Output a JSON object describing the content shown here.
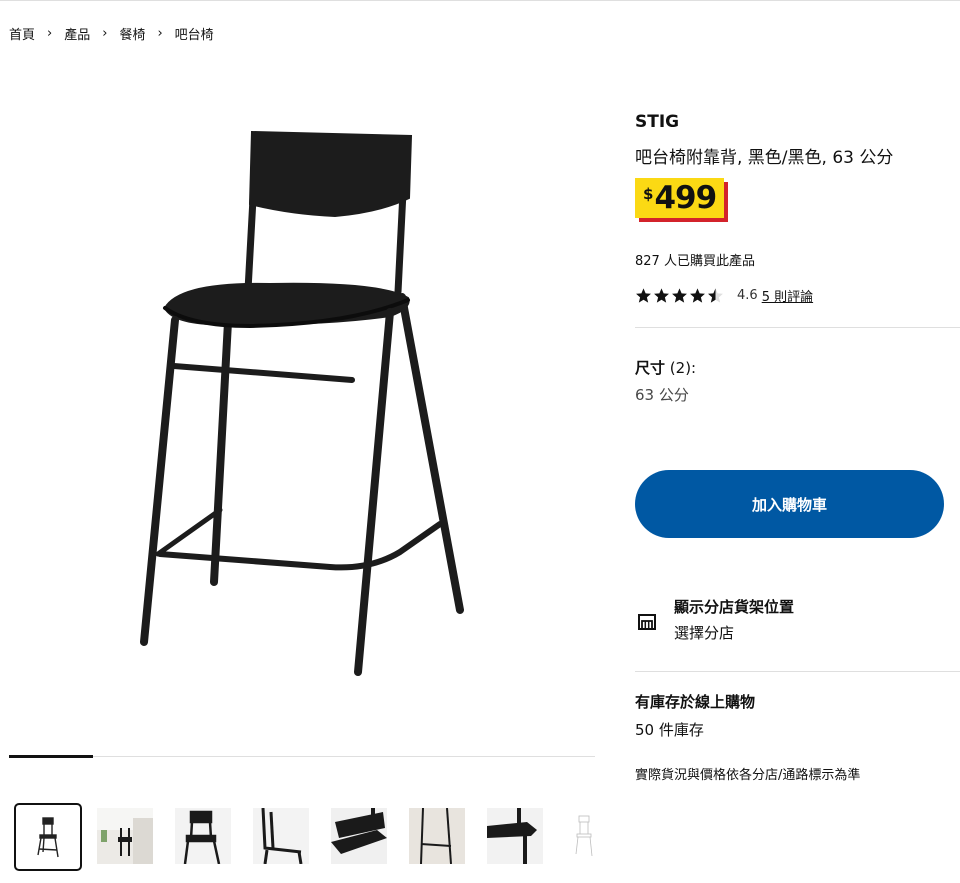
{
  "breadcrumb": [
    "首頁",
    "產品",
    "餐椅",
    "吧台椅"
  ],
  "product": {
    "brand": "STIG",
    "description": "吧台椅附靠背, 黑色/黑色, 63 公分",
    "price_currency": "$",
    "price_value": "499",
    "sold_text": "827 人已購買此產品",
    "rating_value": "4.6",
    "rating_stars": 4.5,
    "reviews_label": "5 則評論",
    "size_label": "尺寸",
    "size_count": "(2):",
    "size_value": "63 公分",
    "add_to_cart": "加入購物車",
    "store_title": "顯示分店貨架位置",
    "store_sub": "選擇分店",
    "stock_title": "有庫存於線上購物",
    "stock_count": "50 件庫存",
    "disclaimer": "實際貨況與價格依各分店/通路標示為準"
  },
  "gallery": {
    "thumbnail_count": 8,
    "active_index": 0,
    "progress": 0.14
  },
  "colors": {
    "price_yellow": "#fbd914",
    "price_red": "#d3232b",
    "button_blue": "#0058a3",
    "chair_black": "#1a1a1a"
  }
}
